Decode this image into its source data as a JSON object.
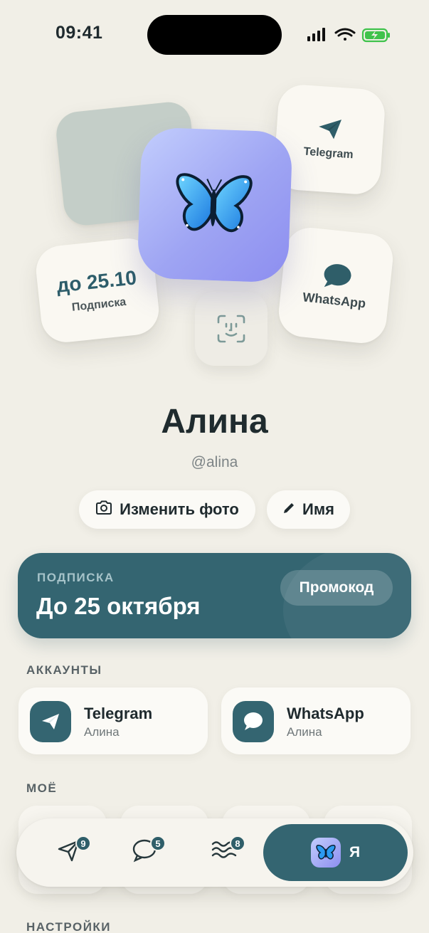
{
  "status_bar": {
    "time": "09:41"
  },
  "hero": {
    "telegram_label": "Telegram",
    "whatsapp_label": "WhatsApp",
    "subscription_date": "до 25.10",
    "subscription_label": "Подписка"
  },
  "profile": {
    "name": "Алина",
    "handle": "@alina",
    "change_photo_label": "Изменить фото",
    "name_button_label": "Имя"
  },
  "subscription": {
    "kicker": "ПОДПИСКА",
    "title": "До 25 октября",
    "promo_label": "Промокод"
  },
  "accounts": {
    "section_title": "АККАУНТЫ",
    "items": [
      {
        "service": "Telegram",
        "user": "Алина",
        "icon": "telegram-plane-icon"
      },
      {
        "service": "WhatsApp",
        "user": "Алина",
        "icon": "chat-bubble-icon"
      }
    ]
  },
  "mine": {
    "section_title": "МОЁ"
  },
  "settings": {
    "section_title": "НАСТРОЙКИ"
  },
  "tab_bar": {
    "tabs": [
      {
        "icon": "send-icon",
        "count": "9"
      },
      {
        "icon": "chat-icon",
        "count": "5"
      },
      {
        "icon": "waves-icon",
        "count": "8"
      }
    ],
    "me_label": "Я"
  },
  "colors": {
    "background": "#f1efe7",
    "accent": "#346571",
    "avatar_gradient_start": "#c2cdfd",
    "avatar_gradient_end": "#8d8ef0"
  }
}
